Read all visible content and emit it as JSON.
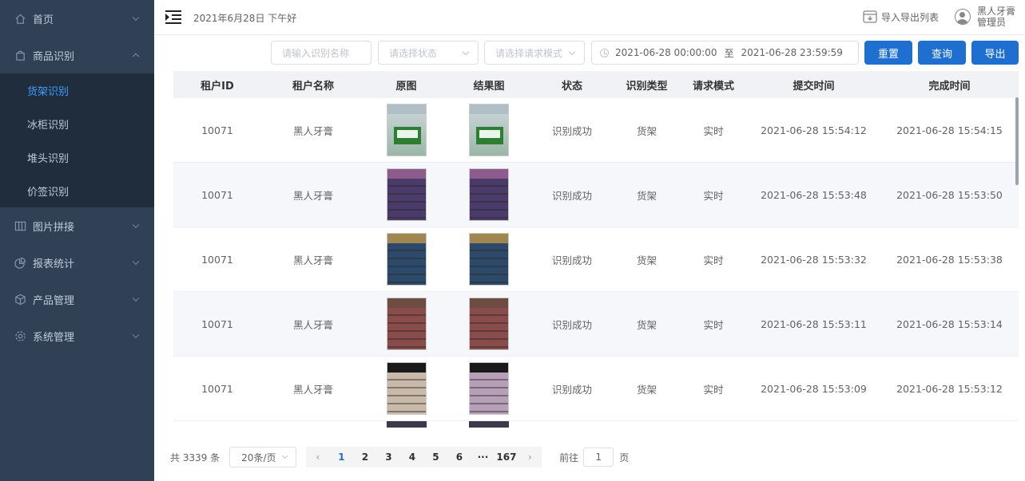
{
  "sidebar": {
    "items": [
      {
        "label": "首页"
      },
      {
        "label": "商品识别",
        "children": [
          "货架识别",
          "冰柜识别",
          "堆头识别",
          "价签识别"
        ]
      },
      {
        "label": "图片拼接"
      },
      {
        "label": "报表统计"
      },
      {
        "label": "产品管理"
      },
      {
        "label": "系统管理"
      }
    ],
    "active_sub": "货架识别"
  },
  "header": {
    "greeting": "2021年6月28日 下午好",
    "import_export": "导入导出列表",
    "user_name": "黑人牙膏",
    "user_role": "管理员"
  },
  "filters": {
    "name_placeholder": "请输入识别名称",
    "status_placeholder": "请选择状态",
    "mode_placeholder": "请选择请求模式",
    "date_start": "2021-06-28 00:00:00",
    "date_sep": "至",
    "date_end": "2021-06-28 23:59:59",
    "reset": "重置",
    "search": "查询",
    "export": "导出"
  },
  "table": {
    "columns": [
      "租户ID",
      "租户名称",
      "原图",
      "结果图",
      "状态",
      "识别类型",
      "请求模式",
      "提交时间",
      "完成时间"
    ],
    "rows": [
      {
        "tenant_id": "10071",
        "tenant_name": "黑人牙膏",
        "status": "识别成功",
        "type": "货架",
        "mode": "实时",
        "submit": "2021-06-28 15:54:12",
        "finish": "2021-06-28 15:54:15"
      },
      {
        "tenant_id": "10071",
        "tenant_name": "黑人牙膏",
        "status": "识别成功",
        "type": "货架",
        "mode": "实时",
        "submit": "2021-06-28 15:53:48",
        "finish": "2021-06-28 15:53:50"
      },
      {
        "tenant_id": "10071",
        "tenant_name": "黑人牙膏",
        "status": "识别成功",
        "type": "货架",
        "mode": "实时",
        "submit": "2021-06-28 15:53:32",
        "finish": "2021-06-28 15:53:38"
      },
      {
        "tenant_id": "10071",
        "tenant_name": "黑人牙膏",
        "status": "识别成功",
        "type": "货架",
        "mode": "实时",
        "submit": "2021-06-28 15:53:11",
        "finish": "2021-06-28 15:53:14"
      },
      {
        "tenant_id": "10071",
        "tenant_name": "黑人牙膏",
        "status": "识别成功",
        "type": "货架",
        "mode": "实时",
        "submit": "2021-06-28 15:53:09",
        "finish": "2021-06-28 15:53:12"
      }
    ]
  },
  "pagination": {
    "total": "共 3339 条",
    "page_size": "20条/页",
    "pages": [
      "1",
      "2",
      "3",
      "4",
      "5",
      "6",
      "···",
      "167"
    ],
    "prev": "‹",
    "next": "›",
    "goto_label": "前往",
    "goto_value": "1",
    "goto_suffix": "页"
  }
}
